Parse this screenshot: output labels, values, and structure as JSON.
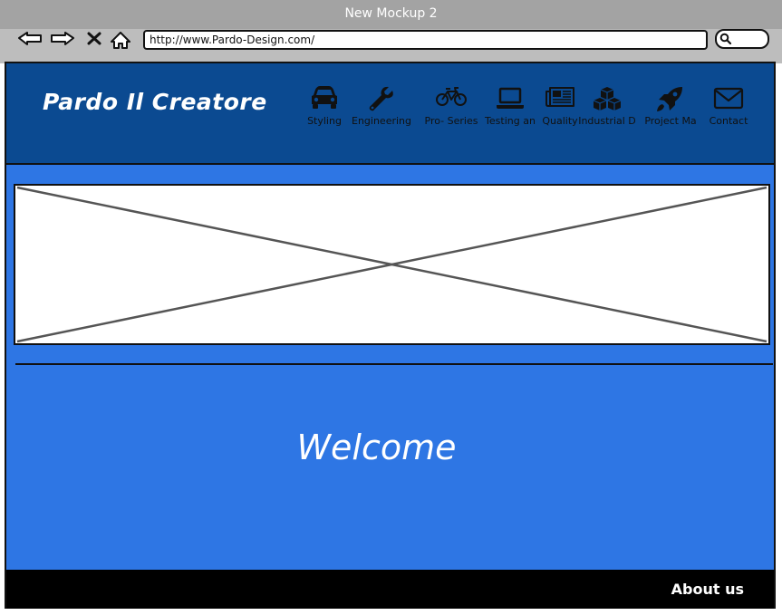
{
  "window": {
    "title": "New Mockup 2"
  },
  "browser": {
    "url": "http://www.Pardo-Design.com/",
    "nav_icons": [
      "back-arrow-icon",
      "forward-arrow-icon",
      "close-icon",
      "home-icon"
    ],
    "search_icon": "search-icon"
  },
  "site": {
    "brand": "Pardo Il Creatore",
    "nav": [
      {
        "label": "Styling",
        "icon": "car-icon"
      },
      {
        "label": "Engineering",
        "icon": "wrench-icon"
      },
      {
        "label": "Pro- Series",
        "icon": "bicycle-icon"
      },
      {
        "label": "Testing  an",
        "icon": "laptop-icon"
      },
      {
        "label": "Quality",
        "icon": "newspaper-icon"
      },
      {
        "label": "Industrial D",
        "icon": "cubes-icon"
      },
      {
        "label": "Project Ma",
        "icon": "rocket-icon"
      },
      {
        "label": "Contact",
        "icon": "envelope-icon"
      }
    ],
    "hero": {
      "type": "image-placeholder"
    },
    "welcome": "Welcome",
    "footer": {
      "about": "About us"
    }
  },
  "colors": {
    "header": "#0b4a91",
    "body": "#2e76e4",
    "footer": "#000000",
    "titlebar": "#a3a3a3",
    "browserbar": "#bdbdbd"
  }
}
